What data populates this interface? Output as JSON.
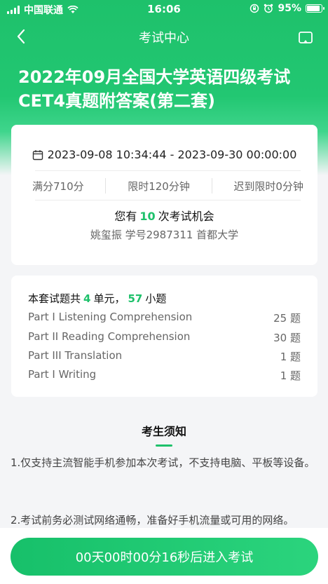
{
  "status_bar": {
    "carrier": "中国联通",
    "time": "16:06",
    "battery_text": "95%",
    "battery_level": 0.95
  },
  "nav": {
    "title": "考试中心",
    "back_icon": "chevron-left-icon",
    "action_icon": "cast-screen-icon"
  },
  "exam": {
    "title": "2022年09月全国大学英语四级考试CET4真题附答案(第二套)"
  },
  "info": {
    "time_range": "2023-09-08 10:34:44 - 2023-09-30 00:00:00",
    "full_score": "满分710分",
    "time_limit": "限时120分钟",
    "late_limit": "迟到限时0分钟",
    "chance_prefix": "您有",
    "chance_count": "10",
    "chance_suffix": "次考试机会",
    "student": "姚玺振  学号2987311 首都大学"
  },
  "summary": {
    "prefix": "本套试题共",
    "units": "4",
    "units_suffix": "单元，",
    "questions": "57",
    "questions_suffix": "小题"
  },
  "parts": [
    {
      "name": "Part I Listening Comprehension",
      "count": "25 题"
    },
    {
      "name": "Part II Reading Comprehension",
      "count": "30 题"
    },
    {
      "name": "Part III Translation",
      "count": "1 题"
    },
    {
      "name": "Part I Writing",
      "count": "1 题"
    }
  ],
  "notice": {
    "title": "考生须知",
    "items": [
      "1.仅支持主流智能手机参加本次考试，不支持电脑、平板等设备。",
      "2.考试前务必测试网络通畅，准备好手机流量或可用的网络。"
    ]
  },
  "start_button": {
    "label": "00天00时00分16秒后进入考试"
  },
  "colors": {
    "accent": "#1ec16b",
    "background": "#f4f5f7"
  }
}
